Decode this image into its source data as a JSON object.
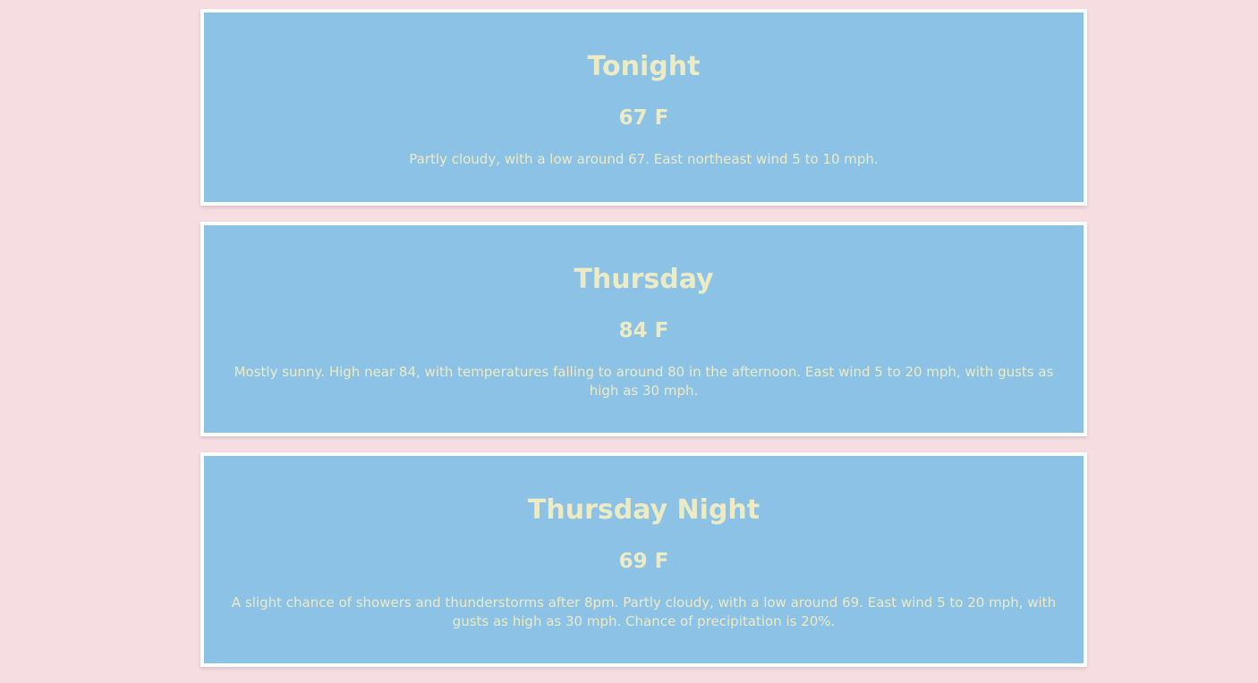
{
  "forecast": [
    {
      "name": "Tonight",
      "temperature": "67 F",
      "description": "Partly cloudy, with a low around 67. East northeast wind 5 to 10 mph."
    },
    {
      "name": "Thursday",
      "temperature": "84 F",
      "description": "Mostly sunny. High near 84, with temperatures falling to around 80 in the afternoon. East wind 5 to 20 mph, with gusts as high as 30 mph."
    },
    {
      "name": "Thursday Night",
      "temperature": "69 F",
      "description": "A slight chance of showers and thunderstorms after 8pm. Partly cloudy, with a low around 69. East wind 5 to 20 mph, with gusts as high as 30 mph. Chance of precipitation is 20%."
    }
  ],
  "colors": {
    "background": "#f5dde1",
    "card": "#8cc2e6",
    "card_border": "#ffffff",
    "text": "#ecebc4"
  }
}
